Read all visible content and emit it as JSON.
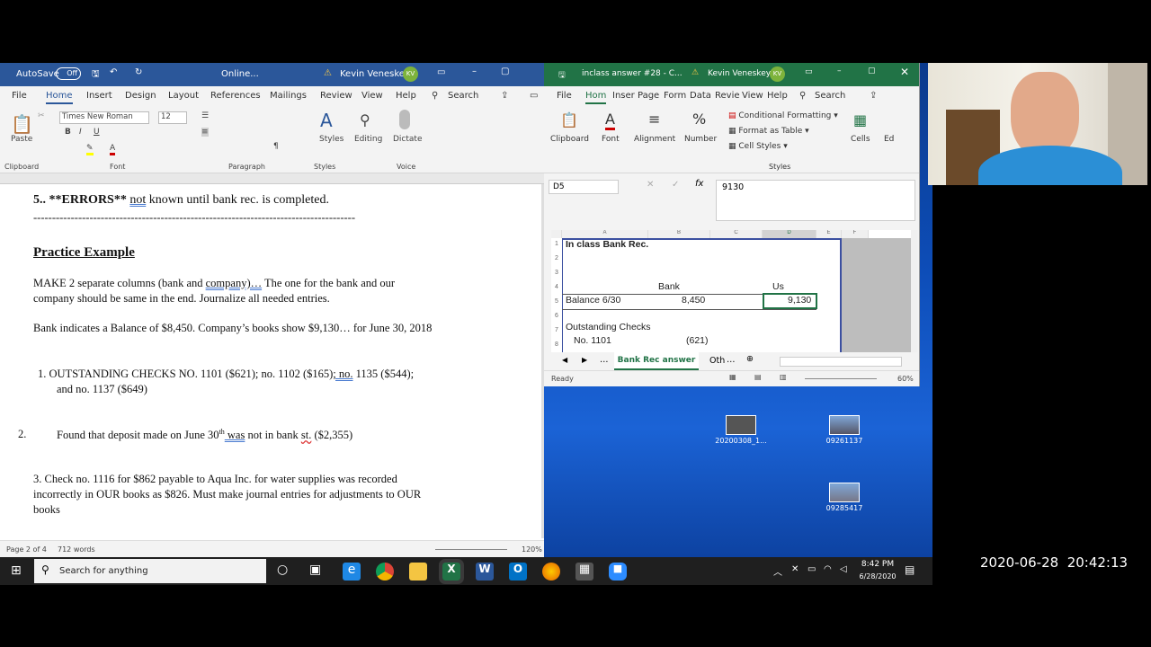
{
  "word": {
    "autosave_label": "AutoSave",
    "autosave_state": "Off",
    "doc_title": "Online...",
    "user_name": "Kevin Veneskey",
    "user_initials": "KV",
    "menu": [
      "File",
      "Home",
      "Insert",
      "Design",
      "Layout",
      "References",
      "Mailings",
      "Review",
      "View",
      "Help"
    ],
    "search": "Search",
    "font_name": "Times New Roman",
    "font_size": "12",
    "groups": {
      "clipboard": "Clipboard",
      "font": "Font",
      "paragraph": "Paragraph",
      "styles": "Styles",
      "voice": "Voice"
    },
    "buttons": {
      "paste": "Paste",
      "styles": "Styles",
      "editing": "Editing",
      "dictate": "Dictate"
    },
    "lines": {
      "l1a": "5.. **ERRORS**  ",
      "l1b": "not",
      "l1c": " known until bank rec. is completed.",
      "dashes": "--------------------------------------------------------------------------------------",
      "heading": "Practice Example",
      "p1a": "MAKE 2 separate columns (bank and ",
      "p1b": "company)…",
      "p1c": "  The one for the bank and our",
      "p2": "company should be same in the end.   Journalize all needed entries.",
      "p3": "Bank indicates a Balance of $8,450.  Company’s books show $9,130… for June 30, 2018",
      "i1a": "1.   OUTSTANDING CHECKS NO. 1101 ($621); no. 1102 ($165)",
      "i1b": ";  no.",
      "i1c": " 1135 ($544);",
      "i1d": "and no. 1137 ($649)",
      "i2n": "2.",
      "i2a": "Found that deposit made on June 30",
      "i2sup": "th",
      "i2b": "  was",
      "i2c": " not in bank ",
      "i2d": "st.",
      "i2e": " ($2,355)",
      "i3a": "3.  Check no. 1116 for $862 payable to Aqua Inc. for water supplies was recorded",
      "i3b": "incorrectly in OUR books as $826.  Must make journal entries for adjustments to OUR",
      "i3c": "books"
    },
    "status": {
      "page": "Page 2 of 4",
      "words": "712 words",
      "zoom": "120%"
    }
  },
  "excel": {
    "title": "inclass answer #28 - C...",
    "user_name": "Kevin Veneskey",
    "user_initials": "KV",
    "menu": [
      "File",
      "Hom",
      "Inser",
      "Page",
      "Form",
      "Data",
      "Revie",
      "View",
      "Help"
    ],
    "search": "Search",
    "ribbon": {
      "clipboard": "Clipboard",
      "font": "Font",
      "alignment": "Alignment",
      "number": "Number",
      "cond": "Conditional Formatting",
      "table": "Format as Table",
      "cellstyles": "Cell Styles",
      "styles": "Styles",
      "cells": "Cells",
      "ed": "Ed"
    },
    "name_box": "D5",
    "formula": "9130",
    "columns": [
      "A",
      "B",
      "C",
      "D",
      "E",
      "F"
    ],
    "rows": [
      "1",
      "2",
      "3",
      "4",
      "5",
      "6",
      "7",
      "8"
    ],
    "cells": {
      "a1": "In class Bank Rec.",
      "b4": "Bank",
      "d4": "Us",
      "a5": "Balance 6/30",
      "b5": "8,450",
      "d5": "9,130",
      "a7": "Outstanding Checks",
      "a8": "No. 1101",
      "b8": "(621)"
    },
    "sheet_tab": "Bank Rec answer",
    "other_tab": "Oth",
    "status_ready": "Ready",
    "zoom": "60%"
  },
  "desktop": {
    "icons": [
      {
        "label": "20200308_1..."
      },
      {
        "label": "09261137"
      },
      {
        "label": "09285417"
      }
    ]
  },
  "taskbar": {
    "search": "Search for anything",
    "time": "8:42 PM",
    "date": "6/28/2020"
  },
  "overlay_timestamp": "2020-06-28  20:42:13"
}
